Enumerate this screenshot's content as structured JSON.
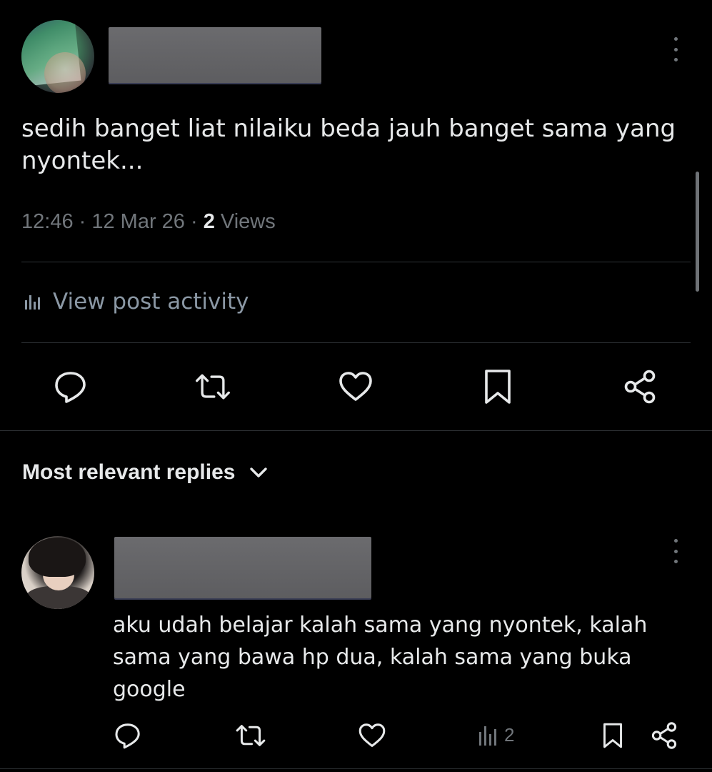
{
  "post": {
    "text": "sedih banget liat nilaiku beda jauh banget sama yang nyontek...",
    "time": "12:46",
    "sep1": " · ",
    "date": "12 Mar 26",
    "sep2": " · ",
    "views_count": "2",
    "views_label": " Views",
    "activity_label": "View post activity",
    "actions": [
      "reply-icon",
      "repost-icon",
      "like-icon",
      "bookmark-icon",
      "share-icon"
    ]
  },
  "replies_section": {
    "title": "Most relevant replies"
  },
  "reply": {
    "text": "aku udah belajar kalah sama yang nyontek, kalah sama yang bawa hp dua, kalah sama yang buka google",
    "views_count": "2",
    "actions": [
      "reply-icon",
      "repost-icon",
      "like-icon",
      "views-icon",
      "bookmark-icon",
      "share-icon"
    ]
  },
  "colors": {
    "background": "#000000",
    "text_primary": "#e7e9ea",
    "text_secondary": "#71767b",
    "icon_primary": "#e7e9ea",
    "icon_secondary": "#71767b",
    "divider": "#2f3336",
    "redaction": "#636366"
  }
}
